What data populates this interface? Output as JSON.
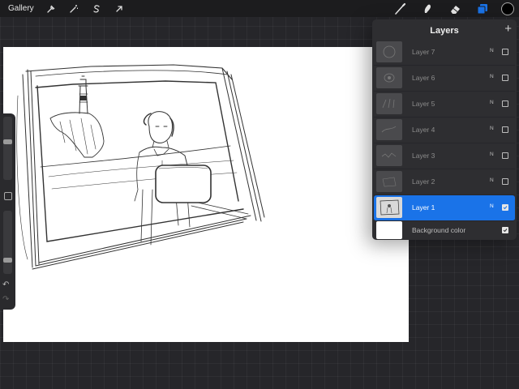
{
  "topbar": {
    "gallery_label": "Gallery",
    "left_tools": [
      "wrench-icon",
      "magic-wand-icon",
      "selection-s-icon",
      "transform-arrow-icon"
    ],
    "right_tools": [
      "brush-icon",
      "smudge-icon",
      "eraser-icon",
      "layers-icon"
    ],
    "active_tool": "layers-icon",
    "current_color": "#000000"
  },
  "sidebar": {
    "undo_icon": "undo-icon",
    "redo_icon": "redo-icon"
  },
  "layers_panel": {
    "title": "Layers",
    "add_icon": "+",
    "layers": [
      {
        "name": "Layer 7",
        "blend": "N",
        "visible": false,
        "active": false
      },
      {
        "name": "Layer 6",
        "blend": "N",
        "visible": false,
        "active": false
      },
      {
        "name": "Layer 5",
        "blend": "N",
        "visible": false,
        "active": false
      },
      {
        "name": "Layer 4",
        "blend": "N",
        "visible": false,
        "active": false
      },
      {
        "name": "Layer 3",
        "blend": "N",
        "visible": false,
        "active": false
      },
      {
        "name": "Layer 2",
        "blend": "N",
        "visible": false,
        "active": false
      },
      {
        "name": "Layer 1",
        "blend": "N",
        "visible": true,
        "active": true
      }
    ],
    "background": {
      "name": "Background color",
      "color": "#ffffff",
      "visible": true
    }
  },
  "colors": {
    "accent": "#1a73e8",
    "topbar_bg": "#1c1c1e",
    "panel_bg": "#2e2e31",
    "canvas_bg": "#ffffff"
  }
}
